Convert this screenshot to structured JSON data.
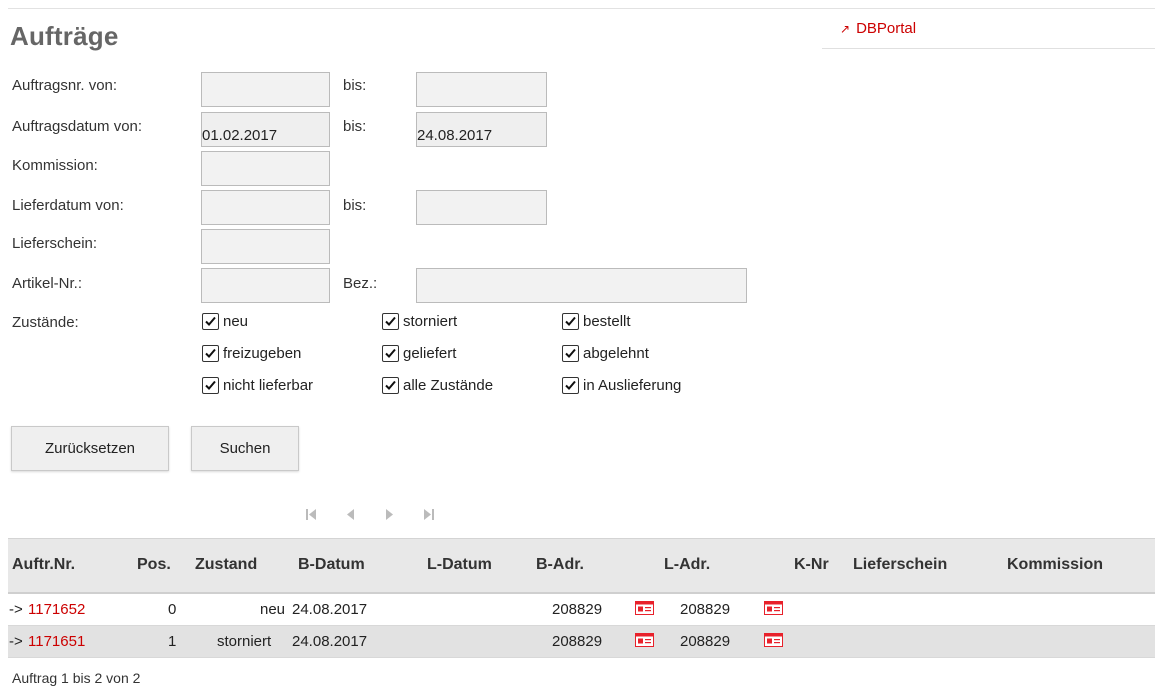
{
  "page": {
    "title": "Aufträge",
    "portal_link": "DBPortal"
  },
  "form": {
    "auftragsnr_label": "Auftragsnr. von:",
    "auftragsnr_bis_label": "bis:",
    "auftragsnr_von_value": "",
    "auftragsnr_bis_value": "",
    "auftragsdatum_label": "Auftragsdatum von:",
    "auftragsdatum_bis_label": "bis:",
    "auftragsdatum_von_value": "01.02.2017",
    "auftragsdatum_bis_value": "24.08.2017",
    "kommission_label": "Kommission:",
    "kommission_value": "",
    "lieferdatum_label": "Lieferdatum von:",
    "lieferdatum_bis_label": "bis:",
    "lieferdatum_von_value": "",
    "lieferdatum_bis_value": "",
    "lieferschein_label": "Lieferschein:",
    "lieferschein_value": "",
    "artikel_label": "Artikel-Nr.:",
    "artikel_value": "",
    "bez_label": "Bez.:",
    "bez_value": "",
    "zustaende_label": "Zustände:",
    "checkboxes": [
      {
        "label": "neu",
        "checked": true
      },
      {
        "label": "storniert",
        "checked": true
      },
      {
        "label": "bestellt",
        "checked": true
      },
      {
        "label": "freizugeben",
        "checked": true
      },
      {
        "label": "geliefert",
        "checked": true
      },
      {
        "label": "abgelehnt",
        "checked": true
      },
      {
        "label": "nicht lieferbar",
        "checked": true
      },
      {
        "label": "alle Zustände",
        "checked": true
      },
      {
        "label": "in Auslieferung",
        "checked": true
      }
    ],
    "reset_label": "Zurücksetzen",
    "search_label": "Suchen"
  },
  "pager": {
    "icons": [
      "first-page-icon",
      "prev-page-icon",
      "next-page-icon",
      "last-page-icon"
    ]
  },
  "table": {
    "headers": [
      "Auftr.Nr.",
      "Pos.",
      "Zustand",
      "B-Datum",
      "L-Datum",
      "B-Adr.",
      "L-Adr.",
      "K-Nr",
      "Lieferschein",
      "Kommission"
    ],
    "rows": [
      {
        "arrow": "->",
        "nr": "1171652",
        "pos": "0",
        "zustand": "neu",
        "b_datum": "24.08.2017",
        "l_datum": "",
        "b_adr": "208829",
        "l_adr": "208829",
        "k_nr": "",
        "lieferschein": "",
        "kommission": ""
      },
      {
        "arrow": "->",
        "nr": "1171651",
        "pos": "1",
        "zustand": "storniert",
        "b_datum": "24.08.2017",
        "l_datum": "",
        "b_adr": "208829",
        "l_adr": "208829",
        "k_nr": "",
        "lieferschein": "",
        "kommission": ""
      }
    ]
  },
  "footer": {
    "summary": "Auftrag 1 bis 2 von 2"
  },
  "colors": {
    "accent": "#cc0000",
    "icon_red": "#e8212b",
    "pager_icon": "#bbbbbb"
  }
}
